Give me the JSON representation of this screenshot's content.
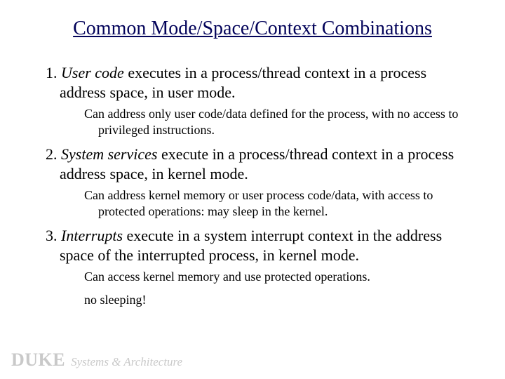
{
  "title": "Common Mode/Space/Context Combinations",
  "items": [
    {
      "num": "1. ",
      "lead": "User code",
      "rest": " executes in a process/thread context in a process address space, in user mode.",
      "subs": [
        "Can address only user code/data defined for the process, with no access to privileged instructions."
      ]
    },
    {
      "num": "2. ",
      "lead": "System services",
      "rest": " execute in a process/thread context in a process address space, in kernel mode.",
      "subs": [
        "Can address kernel memory or user process code/data, with access to protected operations: may sleep in the kernel."
      ]
    },
    {
      "num": "3. ",
      "lead": "Interrupts",
      "rest": " execute in a system interrupt context in the address space of the interrupted process, in kernel mode.",
      "subs": [
        "Can access kernel memory and use protected operations.",
        "no sleeping!"
      ]
    }
  ],
  "footer": {
    "brand": "DUKE",
    "sub": "Systems & Architecture"
  }
}
